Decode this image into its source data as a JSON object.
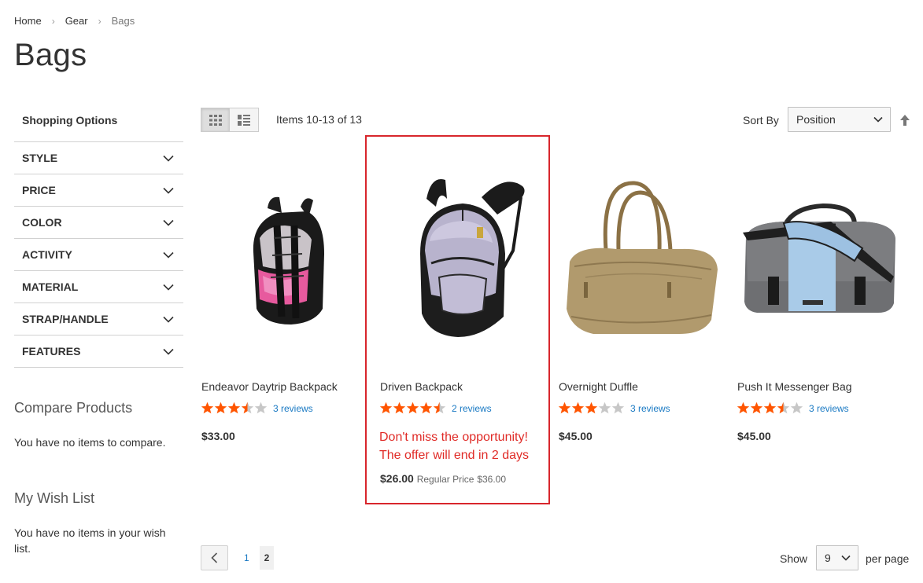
{
  "breadcrumb": {
    "home": "Home",
    "gear": "Gear",
    "current": "Bags",
    "separator": "›"
  },
  "page_title": "Bags",
  "sidebar": {
    "title": "Shopping Options",
    "filters": [
      "STYLE",
      "PRICE",
      "COLOR",
      "ACTIVITY",
      "MATERIAL",
      "STRAP/HANDLE",
      "FEATURES"
    ],
    "compare_title": "Compare Products",
    "compare_text": "You have no items to compare.",
    "wishlist_title": "My Wish List",
    "wishlist_text": "You have no items in your wish list."
  },
  "toolbar": {
    "amount": "Items 10-13 of 13",
    "sort_label": "Sort By",
    "sort_value": "Position",
    "show_label": "Show",
    "limit_value": "9",
    "per_page_label": "per page",
    "pages": [
      "1",
      "2"
    ],
    "current_page": "2"
  },
  "products": [
    {
      "name": "Endeavor Daytrip Backpack",
      "rating": 3.5,
      "reviews": "3 reviews",
      "price": "$33.00"
    },
    {
      "name": "Driven Backpack",
      "rating": 4.5,
      "reviews": "2 reviews",
      "promo_line1": "Don't miss the opportunity!",
      "promo_line2": "The offer will end in 2 days",
      "price": "$26.00",
      "regular_label": "Regular Price",
      "regular_price": "$36.00"
    },
    {
      "name": "Overnight Duffle",
      "rating": 3,
      "reviews": "3 reviews",
      "price": "$45.00"
    },
    {
      "name": "Push It Messenger Bag",
      "rating": 3.5,
      "reviews": "3 reviews",
      "price": "$45.00"
    }
  ],
  "colors": {
    "star": "#ff5501",
    "star_empty": "#c7c7c7",
    "link": "#1979c3",
    "promo": "#e02b27",
    "highlight": "#d8262c"
  }
}
